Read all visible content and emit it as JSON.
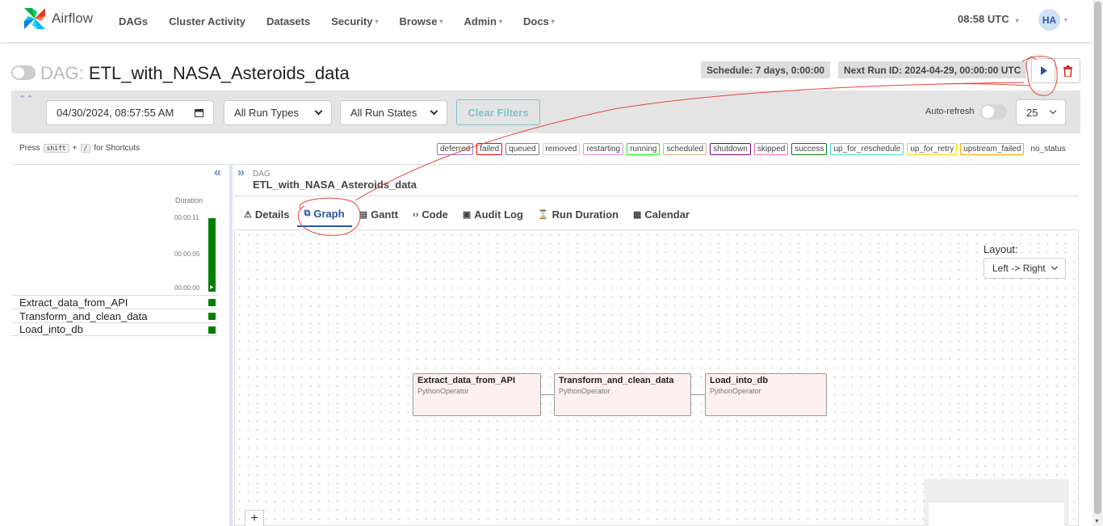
{
  "brand": {
    "name": "Airflow"
  },
  "nav": {
    "items": [
      {
        "label": "DAGs",
        "has_caret": false
      },
      {
        "label": "Cluster Activity",
        "has_caret": false
      },
      {
        "label": "Datasets",
        "has_caret": false
      },
      {
        "label": "Security",
        "has_caret": true
      },
      {
        "label": "Browse",
        "has_caret": true
      },
      {
        "label": "Admin",
        "has_caret": true
      },
      {
        "label": "Docs",
        "has_caret": true
      }
    ],
    "time": "08:58 UTC",
    "user_initials": "HA"
  },
  "dag": {
    "prefix": "DAG:",
    "name": "ETL_with_NASA_Asteroids_data",
    "schedule": "Schedule: 7 days, 0:00:00",
    "next_run": "Next Run ID: 2024-04-29, 00:00:00 UTC"
  },
  "filters": {
    "date": "04/30/2024, 08:57:55 AM",
    "run_types": "All Run Types",
    "run_states": "All Run States",
    "clear_label": "Clear Filters",
    "auto_refresh_label": "Auto-refresh",
    "page_size": "25"
  },
  "shortcuts": {
    "press": "Press",
    "key1": "shift",
    "plus": "+",
    "key2": "/",
    "suffix": "for Shortcuts"
  },
  "legend": [
    {
      "label": "deferred",
      "color": "#9370db"
    },
    {
      "label": "failed",
      "color": "#ff0000"
    },
    {
      "label": "queued",
      "color": "#808080"
    },
    {
      "label": "removed",
      "color": "#d3d3d3"
    },
    {
      "label": "restarting",
      "color": "#ee82ee"
    },
    {
      "label": "running",
      "color": "#00ff00"
    },
    {
      "label": "scheduled",
      "color": "#d2b48c"
    },
    {
      "label": "shutdown",
      "color": "#800080"
    },
    {
      "label": "skipped",
      "color": "#ff69b4"
    },
    {
      "label": "success",
      "color": "#008000"
    },
    {
      "label": "up_for_reschedule",
      "color": "#40e0d0"
    },
    {
      "label": "up_for_retry",
      "color": "#ffd700"
    },
    {
      "label": "upstream_failed",
      "color": "#ffa500"
    },
    {
      "label": "no_status",
      "color": null
    }
  ],
  "grid": {
    "duration_label": "Duration",
    "ticks": [
      "00:00:11",
      "00:00:05",
      "00:00:00"
    ],
    "tasks": [
      "Extract_data_from_API",
      "Transform_and_clean_data",
      "Load_into_db"
    ],
    "success_color": "#008000"
  },
  "panel": {
    "breadcrumb_label": "DAG",
    "breadcrumb_name": "ETL_with_NASA_Asteroids_data",
    "tabs": [
      {
        "label": "Details",
        "icon": "warning-triangle-icon",
        "glyph": "⚠",
        "active": false
      },
      {
        "label": "Graph",
        "icon": "graph-icon",
        "glyph": "⧉",
        "active": true
      },
      {
        "label": "Gantt",
        "icon": "gantt-icon",
        "glyph": "▤",
        "active": false
      },
      {
        "label": "Code",
        "icon": "code-icon",
        "glyph": "‹›",
        "active": false
      },
      {
        "label": "Audit Log",
        "icon": "document-icon",
        "glyph": "▣",
        "active": false
      },
      {
        "label": "Run Duration",
        "icon": "hourglass-icon",
        "glyph": "⌛",
        "active": false
      },
      {
        "label": "Calendar",
        "icon": "calendar-icon",
        "glyph": "▦",
        "active": false
      }
    ]
  },
  "graph": {
    "layout_label": "Layout:",
    "layout_value": "Left -> Right",
    "nodes": [
      {
        "name": "Extract_data_from_API",
        "operator": "PythonOperator"
      },
      {
        "name": "Transform_and_clean_data",
        "operator": "PythonOperator"
      },
      {
        "name": "Load_into_db",
        "operator": "PythonOperator"
      }
    ],
    "zoom_in": "+"
  },
  "colors": {
    "accent": "#2756a1",
    "annotation": "#e8473a",
    "task_fill": "#fdf0ee"
  }
}
